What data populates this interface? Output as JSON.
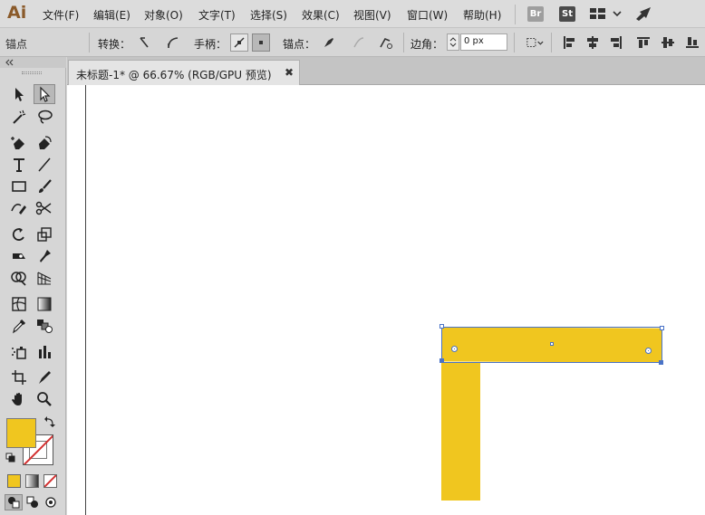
{
  "app": {
    "logo": "Ai"
  },
  "menu": [
    {
      "label": "文件(F)"
    },
    {
      "label": "编辑(E)"
    },
    {
      "label": "对象(O)"
    },
    {
      "label": "文字(T)"
    },
    {
      "label": "选择(S)"
    },
    {
      "label": "效果(C)"
    },
    {
      "label": "视图(V)"
    },
    {
      "label": "窗口(W)"
    },
    {
      "label": "帮助(H)"
    }
  ],
  "menubar_badges": {
    "bridge": "Br",
    "stock": "St"
  },
  "control_bar": {
    "selection_label": "锚点",
    "convert_label": "转换：",
    "handles_label": "手柄：",
    "anchor_label": "锚点：",
    "corner_label": "边角：",
    "corner_value": "0 px"
  },
  "document": {
    "tab_title": "未标题-1* @ 66.67% (RGB/GPU 预览)",
    "close_glyph": "✖"
  },
  "colors": {
    "fill": "#f0c61f",
    "selection": "#4a73c7",
    "stroke_none": "#d23030"
  },
  "tools": [
    "selection-tool",
    "direct-selection-tool",
    "magic-wand-tool",
    "lasso-tool",
    "pen-tool",
    "curvature-tool",
    "type-tool",
    "line-segment-tool",
    "rectangle-tool",
    "paintbrush-tool",
    "shaper-tool",
    "scissors-tool",
    "rotate-tool",
    "scale-tool",
    "width-tool",
    "puppet-warp-tool",
    "shape-builder-tool",
    "perspective-grid-tool",
    "mesh-tool",
    "gradient-tool",
    "eyedropper-tool",
    "blend-tool",
    "symbol-sprayer-tool",
    "column-graph-tool",
    "artboard-tool",
    "slice-tool",
    "hand-tool",
    "zoom-tool"
  ]
}
